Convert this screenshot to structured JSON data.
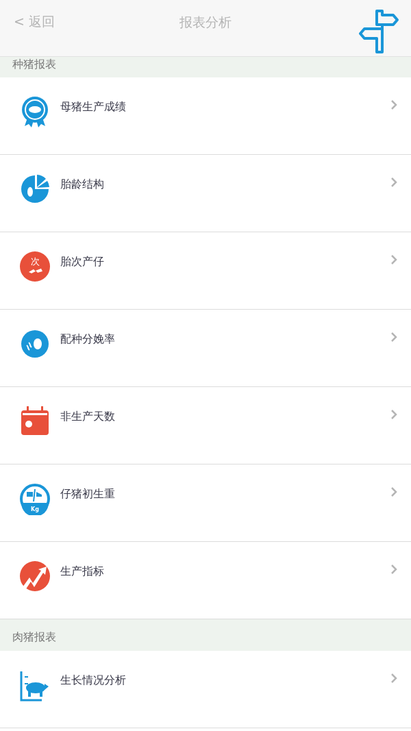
{
  "header": {
    "back": "< 返回",
    "title": "报表分析"
  },
  "sections": [
    {
      "title": "种猪报表",
      "items": [
        {
          "label": "母猪生产成绩"
        },
        {
          "label": "胎龄结构"
        },
        {
          "label": "胎次产仔",
          "icon_text": "次"
        },
        {
          "label": "配种分娩率"
        },
        {
          "label": "非生产天数"
        },
        {
          "label": "仔猪初生重",
          "icon_text": "Kg"
        },
        {
          "label": "生产指标"
        }
      ]
    },
    {
      "title": "肉猪报表",
      "items": [
        {
          "label": "生长情况分析"
        }
      ]
    }
  ]
}
